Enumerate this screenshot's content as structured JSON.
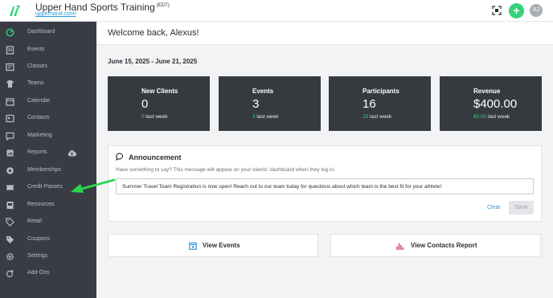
{
  "header": {
    "title": "Upper Hand Sports Training",
    "timezone": "(EDT)",
    "link": "upperhand.com/",
    "avatar_initials": "AJ",
    "add_label": "+",
    "icons": [
      "logo-icon",
      "qr-scan-icon",
      "add-icon"
    ],
    "accent_color": "#36d27a"
  },
  "sidebar": {
    "items": [
      {
        "label": "Dashboard",
        "icon": "dashboard-icon"
      },
      {
        "label": "Events",
        "icon": "events-icon"
      },
      {
        "label": "Classes",
        "icon": "classes-icon"
      },
      {
        "label": "Teams",
        "icon": "teams-icon"
      },
      {
        "label": "Calendar",
        "icon": "calendar-icon"
      },
      {
        "label": "Contacts",
        "icon": "contacts-icon"
      },
      {
        "label": "Marketing",
        "icon": "marketing-icon"
      },
      {
        "label": "Reports",
        "icon": "reports-icon"
      },
      {
        "label": "Memberships",
        "icon": "memberships-icon"
      },
      {
        "label": "Credit Passes",
        "icon": "credit-passes-icon"
      },
      {
        "label": "Resources",
        "icon": "resources-icon"
      },
      {
        "label": "Retail",
        "icon": "retail-icon"
      },
      {
        "label": "Coupons",
        "icon": "coupons-icon"
      },
      {
        "label": "Settings",
        "icon": "settings-icon"
      },
      {
        "label": "Add-Ons",
        "icon": "add-ons-icon"
      }
    ],
    "active": "Dashboard"
  },
  "main": {
    "welcome": "Welcome back, Alexus!",
    "date_range": "June 15, 2025 - June 21, 2025",
    "stats": [
      {
        "title": "New Clients",
        "value": "0",
        "last_week_value": "0",
        "last_week_label": " last week"
      },
      {
        "title": "Events",
        "value": "3",
        "last_week_value": "3",
        "last_week_label": " last week"
      },
      {
        "title": "Participants",
        "value": "16",
        "last_week_value": "15",
        "last_week_label": " last week"
      },
      {
        "title": "Revenue",
        "value": "$400.00",
        "last_week_value": "$0.00",
        "last_week_label": " last week"
      }
    ],
    "announcement": {
      "title": "Announcement",
      "description": "Have something to say? This message will appear on your clients' dashboard when they log in.",
      "message": "Summer Travel Team Registration is now open! Reach out to our team today for questions about which team is the best fit for your athlete!",
      "clear_label": "Clear",
      "save_label": "Save"
    },
    "links": {
      "events_label": "View Events",
      "contacts_report_label": "View Contacts Report"
    }
  }
}
